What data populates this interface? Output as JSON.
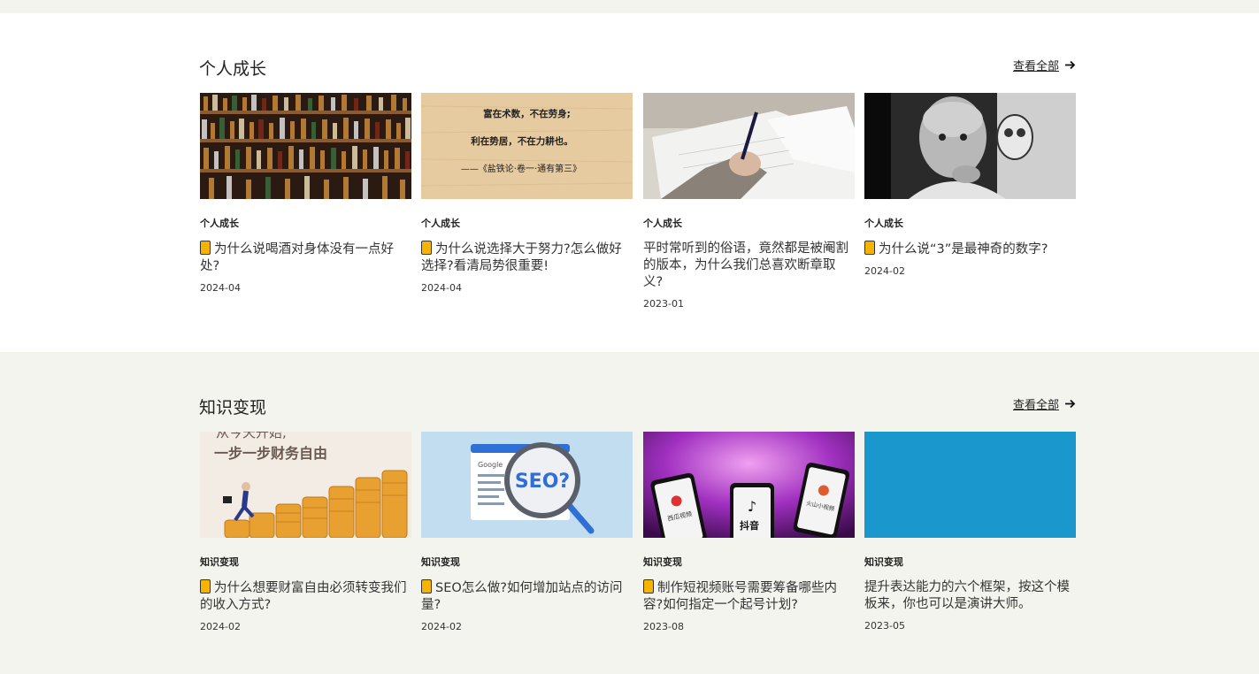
{
  "sections": [
    {
      "title": "个人成长",
      "view_all": "查看全部",
      "cards": [
        {
          "category": "个人成长",
          "title": "为什么说喝酒对身体没有一点好处?",
          "pinned": true,
          "date": "2024-04",
          "thumb": "liquor-shelf"
        },
        {
          "category": "个人成长",
          "title": "为什么说选择大于努力?怎么做好选择?看清局势很重要!",
          "pinned": true,
          "date": "2024-04",
          "thumb": "quote-card"
        },
        {
          "category": "个人成长",
          "title": "平时常听到的俗语，竟然都是被阉割的版本，为什么我们总喜欢断章取义?",
          "pinned": false,
          "date": "2023-01",
          "thumb": "writing-hand"
        },
        {
          "category": "个人成长",
          "title": "为什么说“3”是最神奇的数字?",
          "pinned": true,
          "date": "2024-02",
          "thumb": "portrait-bw"
        }
      ]
    },
    {
      "title": "知识变现",
      "view_all": "查看全部",
      "cards": [
        {
          "category": "知识变现",
          "title": "为什么想要财富自由必须转变我们的收入方式?",
          "pinned": true,
          "date": "2024-02",
          "thumb": "coins-stairs"
        },
        {
          "category": "知识变现",
          "title": "SEO怎么做?如何增加站点的访问量?",
          "pinned": true,
          "date": "2024-02",
          "thumb": "seo-magnifier"
        },
        {
          "category": "知识变现",
          "title": "制作短视频账号需要筹备哪些内容?如何指定一个起号计划?",
          "pinned": true,
          "date": "2023-08",
          "thumb": "phones-apps"
        },
        {
          "category": "知识变现",
          "title": "提升表达能力的六个框架，按这个模板来，你也可以是演讲大师。",
          "pinned": false,
          "date": "2023-05",
          "thumb": "blue-block"
        }
      ]
    }
  ],
  "thumb_text": {
    "quote_line1": "富在术数，不在劳身;",
    "quote_line2": "利在势居，不在力耕也。",
    "quote_line3": "——《盐铁论·卷一·通有第三》",
    "coins_line1": "一步一步财务自由",
    "coins_line0": "从今天开始,",
    "seo_label": "SEO?",
    "seo_google": "Google",
    "douyin": "抖音",
    "xigua": "西瓜视频",
    "huoshan": "火山小视频"
  }
}
